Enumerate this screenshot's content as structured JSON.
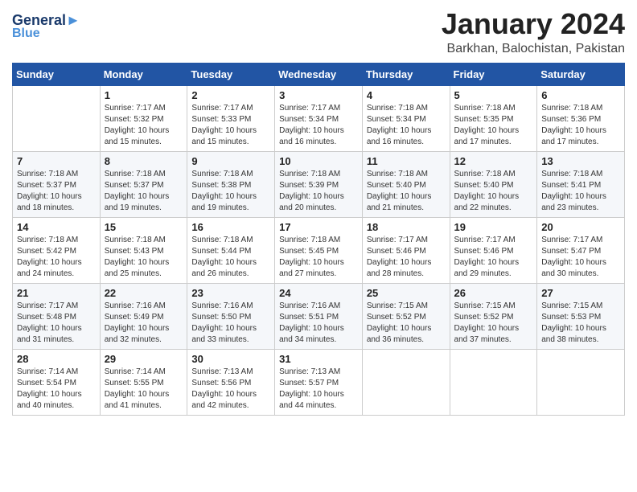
{
  "header": {
    "logo_line1": "General",
    "logo_line2": "Blue",
    "month": "January 2024",
    "location": "Barkhan, Balochistan, Pakistan"
  },
  "weekdays": [
    "Sunday",
    "Monday",
    "Tuesday",
    "Wednesday",
    "Thursday",
    "Friday",
    "Saturday"
  ],
  "weeks": [
    [
      {
        "day": "",
        "info": ""
      },
      {
        "day": "1",
        "info": "Sunrise: 7:17 AM\nSunset: 5:32 PM\nDaylight: 10 hours\nand 15 minutes."
      },
      {
        "day": "2",
        "info": "Sunrise: 7:17 AM\nSunset: 5:33 PM\nDaylight: 10 hours\nand 15 minutes."
      },
      {
        "day": "3",
        "info": "Sunrise: 7:17 AM\nSunset: 5:34 PM\nDaylight: 10 hours\nand 16 minutes."
      },
      {
        "day": "4",
        "info": "Sunrise: 7:18 AM\nSunset: 5:34 PM\nDaylight: 10 hours\nand 16 minutes."
      },
      {
        "day": "5",
        "info": "Sunrise: 7:18 AM\nSunset: 5:35 PM\nDaylight: 10 hours\nand 17 minutes."
      },
      {
        "day": "6",
        "info": "Sunrise: 7:18 AM\nSunset: 5:36 PM\nDaylight: 10 hours\nand 17 minutes."
      }
    ],
    [
      {
        "day": "7",
        "info": "Sunrise: 7:18 AM\nSunset: 5:37 PM\nDaylight: 10 hours\nand 18 minutes."
      },
      {
        "day": "8",
        "info": "Sunrise: 7:18 AM\nSunset: 5:37 PM\nDaylight: 10 hours\nand 19 minutes."
      },
      {
        "day": "9",
        "info": "Sunrise: 7:18 AM\nSunset: 5:38 PM\nDaylight: 10 hours\nand 19 minutes."
      },
      {
        "day": "10",
        "info": "Sunrise: 7:18 AM\nSunset: 5:39 PM\nDaylight: 10 hours\nand 20 minutes."
      },
      {
        "day": "11",
        "info": "Sunrise: 7:18 AM\nSunset: 5:40 PM\nDaylight: 10 hours\nand 21 minutes."
      },
      {
        "day": "12",
        "info": "Sunrise: 7:18 AM\nSunset: 5:40 PM\nDaylight: 10 hours\nand 22 minutes."
      },
      {
        "day": "13",
        "info": "Sunrise: 7:18 AM\nSunset: 5:41 PM\nDaylight: 10 hours\nand 23 minutes."
      }
    ],
    [
      {
        "day": "14",
        "info": "Sunrise: 7:18 AM\nSunset: 5:42 PM\nDaylight: 10 hours\nand 24 minutes."
      },
      {
        "day": "15",
        "info": "Sunrise: 7:18 AM\nSunset: 5:43 PM\nDaylight: 10 hours\nand 25 minutes."
      },
      {
        "day": "16",
        "info": "Sunrise: 7:18 AM\nSunset: 5:44 PM\nDaylight: 10 hours\nand 26 minutes."
      },
      {
        "day": "17",
        "info": "Sunrise: 7:18 AM\nSunset: 5:45 PM\nDaylight: 10 hours\nand 27 minutes."
      },
      {
        "day": "18",
        "info": "Sunrise: 7:17 AM\nSunset: 5:46 PM\nDaylight: 10 hours\nand 28 minutes."
      },
      {
        "day": "19",
        "info": "Sunrise: 7:17 AM\nSunset: 5:46 PM\nDaylight: 10 hours\nand 29 minutes."
      },
      {
        "day": "20",
        "info": "Sunrise: 7:17 AM\nSunset: 5:47 PM\nDaylight: 10 hours\nand 30 minutes."
      }
    ],
    [
      {
        "day": "21",
        "info": "Sunrise: 7:17 AM\nSunset: 5:48 PM\nDaylight: 10 hours\nand 31 minutes."
      },
      {
        "day": "22",
        "info": "Sunrise: 7:16 AM\nSunset: 5:49 PM\nDaylight: 10 hours\nand 32 minutes."
      },
      {
        "day": "23",
        "info": "Sunrise: 7:16 AM\nSunset: 5:50 PM\nDaylight: 10 hours\nand 33 minutes."
      },
      {
        "day": "24",
        "info": "Sunrise: 7:16 AM\nSunset: 5:51 PM\nDaylight: 10 hours\nand 34 minutes."
      },
      {
        "day": "25",
        "info": "Sunrise: 7:15 AM\nSunset: 5:52 PM\nDaylight: 10 hours\nand 36 minutes."
      },
      {
        "day": "26",
        "info": "Sunrise: 7:15 AM\nSunset: 5:52 PM\nDaylight: 10 hours\nand 37 minutes."
      },
      {
        "day": "27",
        "info": "Sunrise: 7:15 AM\nSunset: 5:53 PM\nDaylight: 10 hours\nand 38 minutes."
      }
    ],
    [
      {
        "day": "28",
        "info": "Sunrise: 7:14 AM\nSunset: 5:54 PM\nDaylight: 10 hours\nand 40 minutes."
      },
      {
        "day": "29",
        "info": "Sunrise: 7:14 AM\nSunset: 5:55 PM\nDaylight: 10 hours\nand 41 minutes."
      },
      {
        "day": "30",
        "info": "Sunrise: 7:13 AM\nSunset: 5:56 PM\nDaylight: 10 hours\nand 42 minutes."
      },
      {
        "day": "31",
        "info": "Sunrise: 7:13 AM\nSunset: 5:57 PM\nDaylight: 10 hours\nand 44 minutes."
      },
      {
        "day": "",
        "info": ""
      },
      {
        "day": "",
        "info": ""
      },
      {
        "day": "",
        "info": ""
      }
    ]
  ]
}
